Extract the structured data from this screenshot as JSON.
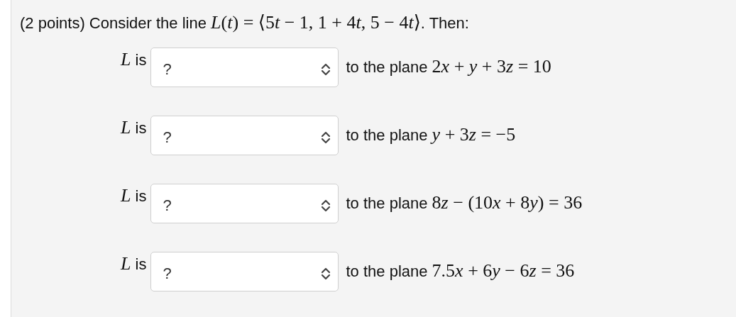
{
  "problem": {
    "points": "(2 points)",
    "intro": "Consider the line",
    "line_equation": "L(t) = ⟨5t − 1, 1 + 4t, 5 − 4t⟩",
    "outro": ". Then:"
  },
  "rows": [
    {
      "subject": "L",
      "verb": "is",
      "select_value": "?",
      "statement": "to the plane",
      "plane": "2x + y + 3z = 10"
    },
    {
      "subject": "L",
      "verb": "is",
      "select_value": "?",
      "statement": "to the plane",
      "plane": "y + 3z = −5"
    },
    {
      "subject": "L",
      "verb": "is",
      "select_value": "?",
      "statement": "to the plane",
      "plane": "8z − (10x + 8y) = 36"
    },
    {
      "subject": "L",
      "verb": "is",
      "select_value": "?",
      "statement": "to the plane",
      "plane": "7.5x + 6y − 6z = 36"
    }
  ]
}
